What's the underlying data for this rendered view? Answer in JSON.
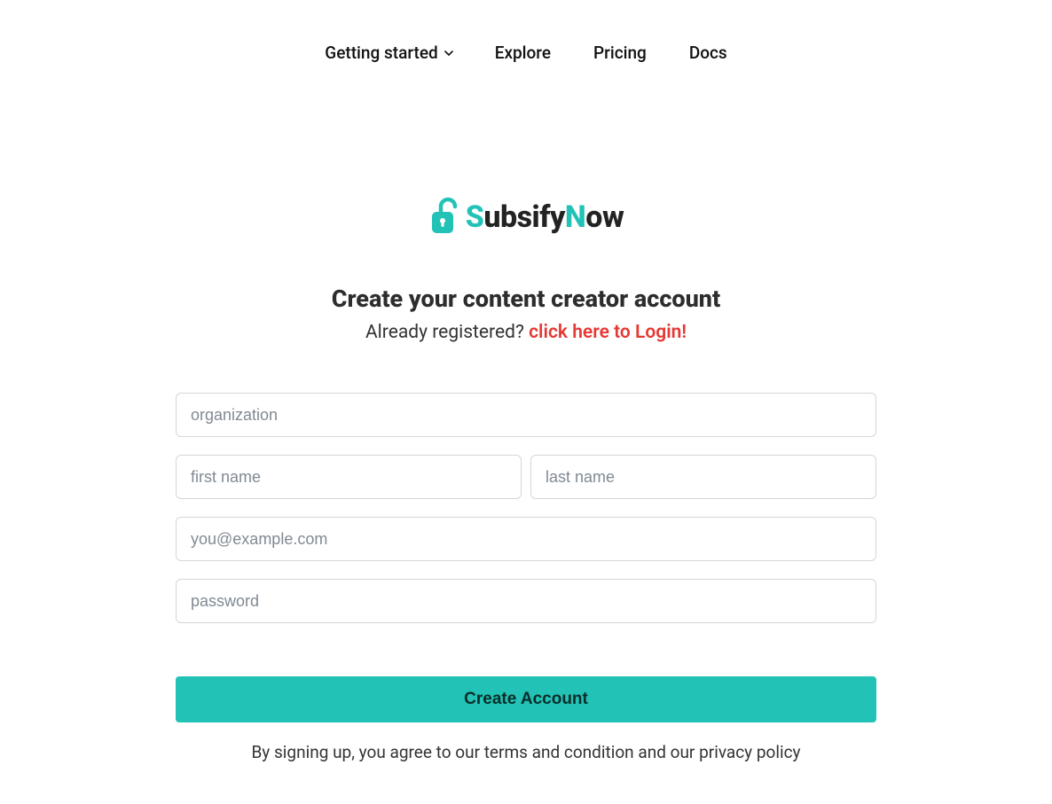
{
  "nav": {
    "items": [
      {
        "label": "Getting started",
        "hasDropdown": true
      },
      {
        "label": "Explore",
        "hasDropdown": false
      },
      {
        "label": "Pricing",
        "hasDropdown": false
      },
      {
        "label": "Docs",
        "hasDropdown": false
      }
    ]
  },
  "logo": {
    "text_parts": {
      "s": "S",
      "ubs": "ubsify",
      "n": "N",
      "ow": "ow"
    }
  },
  "signup": {
    "heading": "Create your content creator account",
    "already": "Already registered? ",
    "login_link": "click here to Login!",
    "placeholders": {
      "organization": "organization",
      "first_name": "first name",
      "last_name": "last name",
      "email": "you@example.com",
      "password": "password"
    },
    "submit": "Create Account",
    "terms": "By signing up, you agree to our terms and condition and our privacy policy"
  },
  "colors": {
    "accent": "#22c3b6",
    "danger": "#e53935"
  }
}
